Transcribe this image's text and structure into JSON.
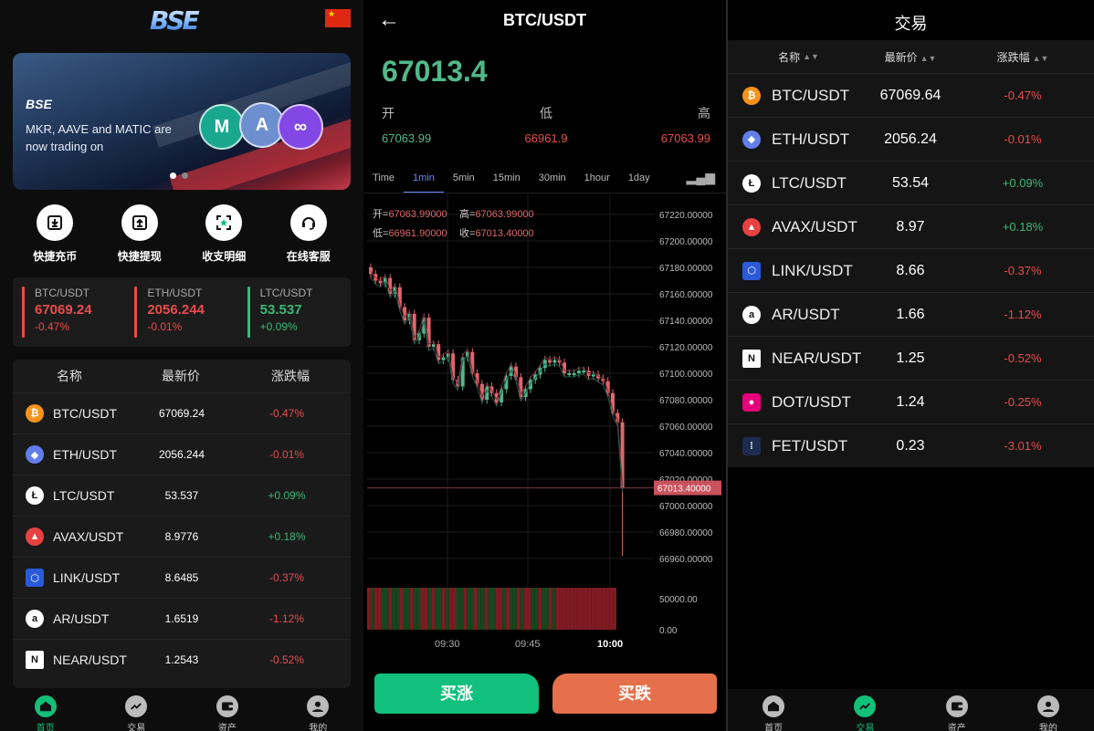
{
  "home": {
    "logo": "BSE",
    "banner": {
      "logo": "BSE",
      "text": "MKR, AAVE and MATIC are now trading on",
      "coins": [
        "M",
        "A",
        "∞"
      ]
    },
    "quick": [
      {
        "label": "快捷充币",
        "icon": "deposit-icon"
      },
      {
        "label": "快捷提现",
        "icon": "withdraw-icon"
      },
      {
        "label": "收支明细",
        "icon": "records-icon"
      },
      {
        "label": "在线客服",
        "icon": "support-icon"
      }
    ],
    "tickers": [
      {
        "name": "BTC/USDT",
        "price": "67069.24",
        "change": "-0.47%",
        "color": "#ea4c4c"
      },
      {
        "name": "ETH/USDT",
        "price": "2056.244",
        "change": "-0.01%",
        "color": "#ea4c4c"
      },
      {
        "name": "LTC/USDT",
        "price": "53.537",
        "change": "+0.09%",
        "color": "#3cb878"
      }
    ],
    "market_head": {
      "name": "名称",
      "price": "最新价",
      "change": "涨跌幅"
    },
    "market": [
      {
        "name": "BTC/USDT",
        "price": "67069.24",
        "change": "-0.47%",
        "up": false,
        "icon": "bitcoin-icon"
      },
      {
        "name": "ETH/USDT",
        "price": "2056.244",
        "change": "-0.01%",
        "up": false,
        "icon": "ethereum-icon"
      },
      {
        "name": "LTC/USDT",
        "price": "53.537",
        "change": "+0.09%",
        "up": true,
        "icon": "litecoin-icon"
      },
      {
        "name": "AVAX/USDT",
        "price": "8.9776",
        "change": "+0.18%",
        "up": true,
        "icon": "avax-icon"
      },
      {
        "name": "LINK/USDT",
        "price": "8.6485",
        "change": "-0.37%",
        "up": false,
        "icon": "chainlink-icon"
      },
      {
        "name": "AR/USDT",
        "price": "1.6519",
        "change": "-1.12%",
        "up": false,
        "icon": "arweave-icon"
      },
      {
        "name": "NEAR/USDT",
        "price": "1.2543",
        "change": "-0.52%",
        "up": false,
        "icon": "near-icon"
      }
    ],
    "tabs": [
      {
        "label": "首页",
        "icon": "home-icon",
        "active": true
      },
      {
        "label": "交易",
        "icon": "trade-icon",
        "active": false
      },
      {
        "label": "资产",
        "icon": "wallet-icon",
        "active": false
      },
      {
        "label": "我的",
        "icon": "user-icon",
        "active": false
      }
    ]
  },
  "detail": {
    "title": "BTC/USDT",
    "price": "67013.4",
    "open_label": "开",
    "low_label": "低",
    "high_label": "高",
    "open": "67063.99",
    "low": "66961.9",
    "high": "67063.99",
    "timeframes": [
      "Time",
      "1min",
      "5min",
      "15min",
      "30min",
      "1hour",
      "1day"
    ],
    "active_timeframe": "1min",
    "ohlc_info": {
      "open_label": "开=",
      "open": "67063.99000",
      "high_label": "高=",
      "high": "67063.99000",
      "low_label": "低=",
      "low": "66961.90000",
      "close_label": "收=",
      "close": "67013.40000"
    },
    "y_ticks": [
      "67220.00000",
      "67200.00000",
      "67180.00000",
      "67160.00000",
      "67140.00000",
      "67120.00000",
      "67100.00000",
      "67080.00000",
      "67060.00000",
      "67040.00000",
      "67020.00000",
      "67000.00000",
      "66980.00000",
      "66960.00000"
    ],
    "current_price_tag": "67013.40000",
    "volume_ticks": [
      "50000.00",
      "0.00"
    ],
    "x_ticks": [
      "09:30",
      "09:45",
      "10:00"
    ],
    "buy_label": "买涨",
    "sell_label": "买跌",
    "up_color": "#10c07c",
    "down_color": "#e5704b"
  },
  "trade": {
    "title": "交易",
    "head": {
      "name": "名称",
      "price": "最新价",
      "change": "涨跌幅"
    },
    "rows": [
      {
        "name": "BTC/USDT",
        "price": "67069.64",
        "change": "-0.47%",
        "up": false,
        "icon": "bitcoin-icon"
      },
      {
        "name": "ETH/USDT",
        "price": "2056.24",
        "change": "-0.01%",
        "up": false,
        "icon": "ethereum-icon"
      },
      {
        "name": "LTC/USDT",
        "price": "53.54",
        "change": "+0.09%",
        "up": true,
        "icon": "litecoin-icon"
      },
      {
        "name": "AVAX/USDT",
        "price": "8.97",
        "change": "+0.18%",
        "up": true,
        "icon": "avax-icon"
      },
      {
        "name": "LINK/USDT",
        "price": "8.66",
        "change": "-0.37%",
        "up": false,
        "icon": "chainlink-icon"
      },
      {
        "name": "AR/USDT",
        "price": "1.66",
        "change": "-1.12%",
        "up": false,
        "icon": "arweave-icon"
      },
      {
        "name": "NEAR/USDT",
        "price": "1.25",
        "change": "-0.52%",
        "up": false,
        "icon": "near-icon"
      },
      {
        "name": "DOT/USDT",
        "price": "1.24",
        "change": "-0.25%",
        "up": false,
        "icon": "polkadot-icon"
      },
      {
        "name": "FET/USDT",
        "price": "0.23",
        "change": "-3.01%",
        "up": false,
        "icon": "fetch-icon"
      }
    ],
    "tabs": [
      {
        "label": "首页",
        "icon": "home-icon",
        "active": false
      },
      {
        "label": "交易",
        "icon": "trade-icon",
        "active": true
      },
      {
        "label": "资产",
        "icon": "wallet-icon",
        "active": false
      },
      {
        "label": "我的",
        "icon": "user-icon",
        "active": false
      }
    ]
  }
}
